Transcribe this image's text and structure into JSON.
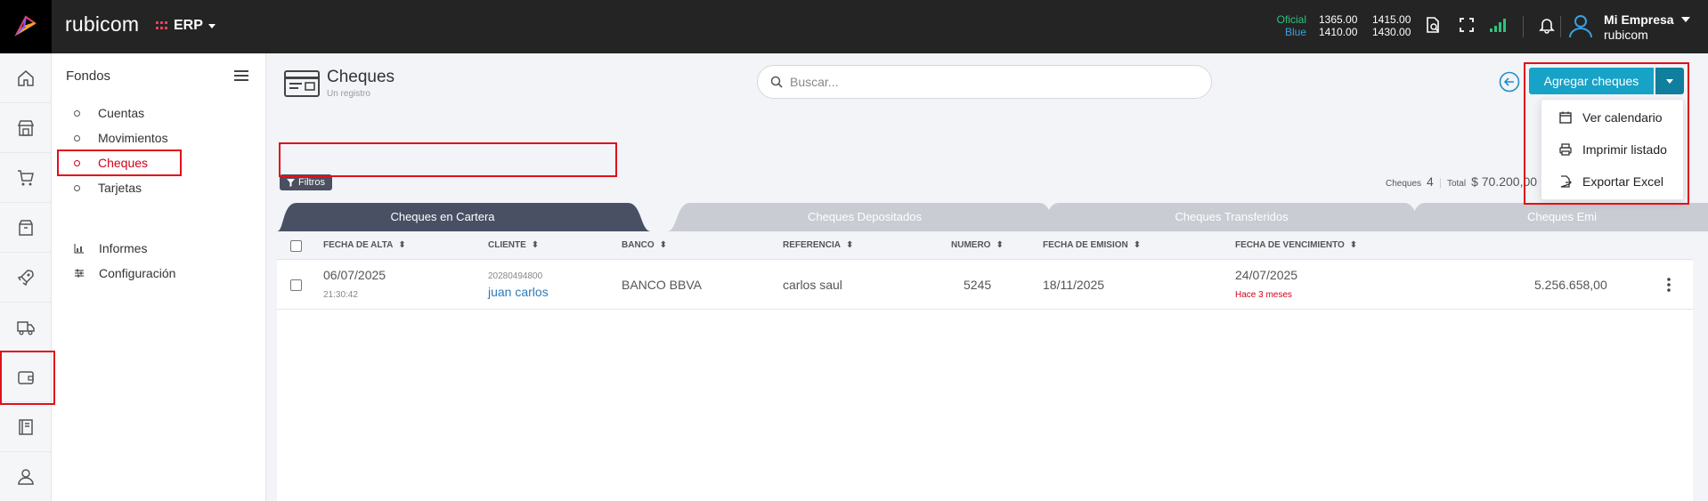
{
  "app": {
    "brand": "rubicom",
    "module": "ERP"
  },
  "rates": {
    "oficial_label": "Oficial",
    "blue_label": "Blue",
    "oficial_buy": "1365.00",
    "oficial_sell": "1415.00",
    "blue_buy": "1410.00",
    "blue_sell": "1430.00"
  },
  "user": {
    "company": "Mi Empresa",
    "org": "rubicom"
  },
  "sidebar": {
    "title": "Fondos",
    "items": [
      {
        "label": "Cuentas"
      },
      {
        "label": "Movimientos"
      },
      {
        "label": "Cheques"
      },
      {
        "label": "Tarjetas"
      }
    ],
    "links": [
      {
        "label": "Informes"
      },
      {
        "label": "Configuración"
      }
    ]
  },
  "page": {
    "title": "Cheques",
    "subtitle": "Un registro"
  },
  "search": {
    "placeholder": "Buscar..."
  },
  "filters_label": "Filtros",
  "stats": {
    "count_label": "Cheques",
    "count": "4",
    "total_label": "Total",
    "total": "$ 70.200,00"
  },
  "tabs": [
    {
      "label": "Cheques en Cartera"
    },
    {
      "label": "Cheques Depositados"
    },
    {
      "label": "Cheques Transferidos"
    },
    {
      "label": "Cheques Emi"
    }
  ],
  "table": {
    "headers": [
      "FECHA DE ALTA",
      "CLIENTE",
      "BANCO",
      "REFERENCIA",
      "NUMERO",
      "FECHA DE EMISION",
      "FECHA DE VENCIMIENTO"
    ],
    "rows": [
      {
        "fecha_alta": "06/07/2025",
        "hora_alta": "21:30:42",
        "cliente_id": "20280494800",
        "cliente": "juan carlos",
        "banco": "BANCO BBVA",
        "referencia": "carlos saul",
        "numero": "5245",
        "fecha_emision": "18/11/2025",
        "fecha_vencimiento": "24/07/2025",
        "vencimiento_note": "Hace 3 meses",
        "importe": "5.256.658,00"
      }
    ]
  },
  "actions": {
    "add_label": "Agregar cheques",
    "dropdown": [
      {
        "label": "Ver calendario"
      },
      {
        "label": "Imprimir listado"
      },
      {
        "label": "Exportar Excel"
      }
    ]
  }
}
